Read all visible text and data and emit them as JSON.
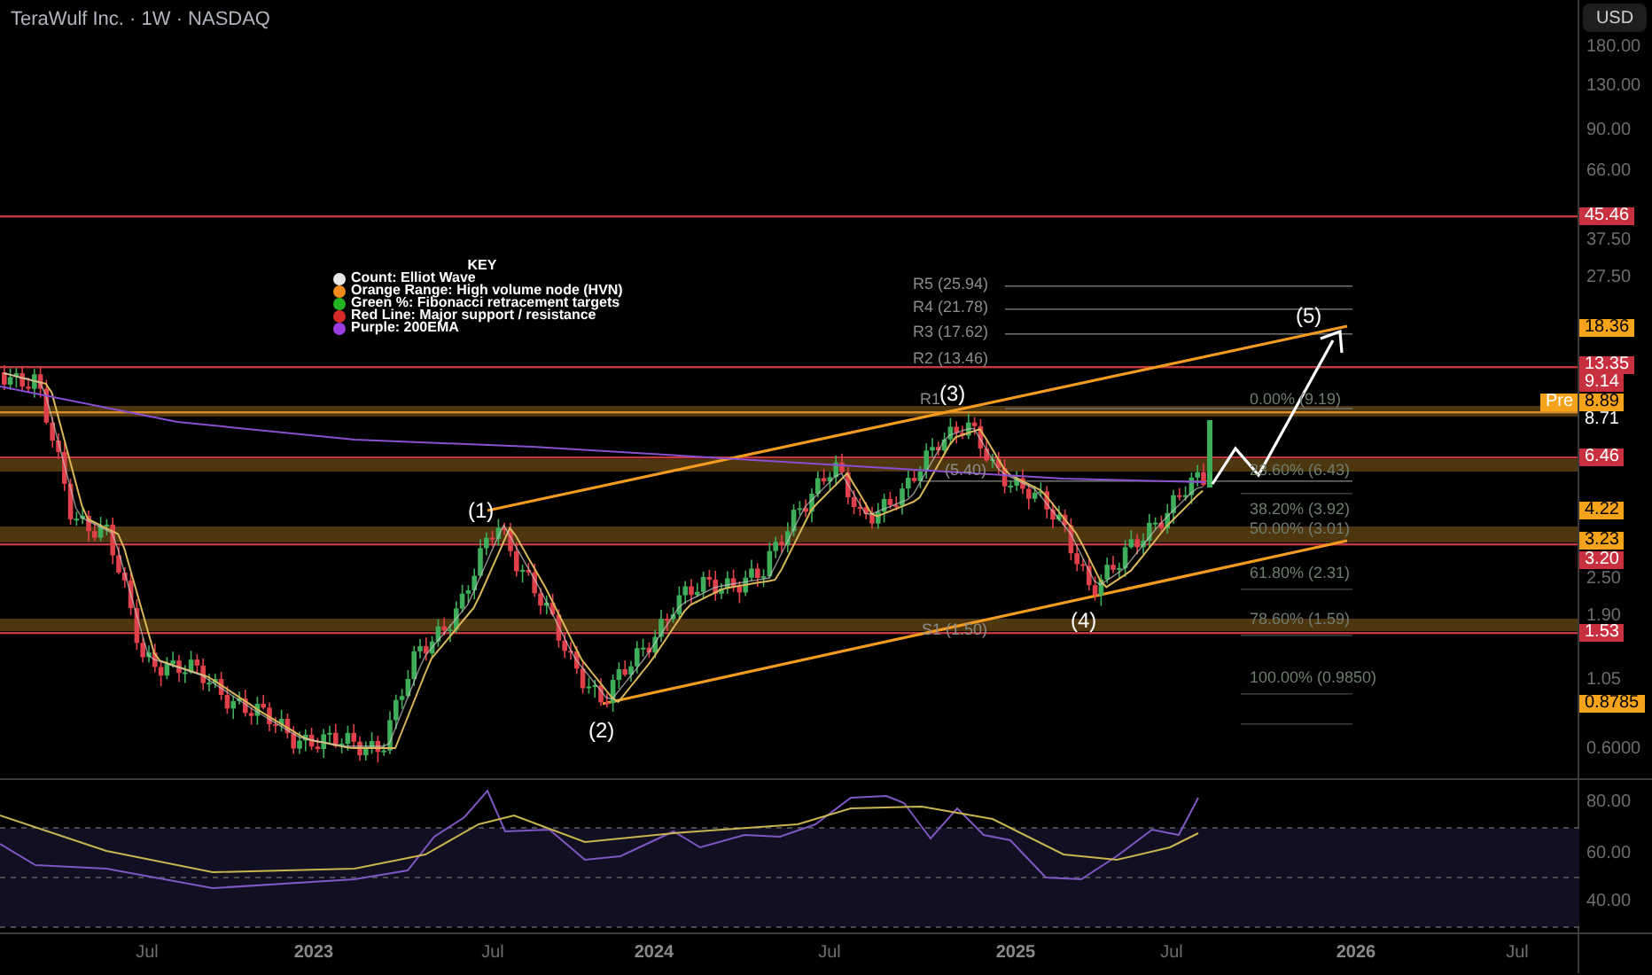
{
  "header": {
    "title": "TeraWulf Inc. · 1W · NASDAQ"
  },
  "currency_button": "USD",
  "legend": {
    "title": "KEY",
    "items": [
      {
        "label": "Count: Elliot Wave",
        "color": "#e8e8e8"
      },
      {
        "label": "Orange Range: High volume node (HVN)",
        "color": "#f08a1c"
      },
      {
        "label": "Green %: Fibonacci retracement targets",
        "color": "#22b422"
      },
      {
        "label": "Red Line: Major support / resistance",
        "color": "#d92a2a"
      },
      {
        "label": "Purple: 200EMA",
        "color": "#9b3de0"
      }
    ]
  },
  "wave_labels": [
    "(1)",
    "(2)",
    "(3)",
    "(4)",
    "(5)"
  ],
  "pivot_labels": [
    "R5 (25.94)",
    "R4 (21.78)",
    "R3 (17.62)",
    "R2 (13.46)",
    "R1",
    "(5.40)",
    "S1 (1.50)"
  ],
  "fib_labels": [
    "0.00% (9.19)",
    "23.60% (6.43)",
    "38.20% (3.92)",
    "50.00% (3.01)",
    "61.80% (2.31)",
    "78.60% (1.59)",
    "100.00% (0.9850)"
  ],
  "price_axis": {
    "ticks": [
      "180.00",
      "130.00",
      "90.00",
      "66.00",
      "37.50",
      "27.50",
      "2.50",
      "1.90",
      "1.05",
      "0.6000"
    ]
  },
  "price_tags": [
    {
      "value": "45.46",
      "kind": "alert"
    },
    {
      "value": "18.36",
      "kind": "drawing"
    },
    {
      "value": "13.35",
      "kind": "alert"
    },
    {
      "value": "9.14",
      "kind": "alert"
    },
    {
      "value": "8.89",
      "kind": "drawing"
    },
    {
      "value": "8.71",
      "kind": "last"
    },
    {
      "value": "6.46",
      "kind": "alert"
    },
    {
      "value": "4.22",
      "kind": "drawing"
    },
    {
      "value": "3.23",
      "kind": "drawing"
    },
    {
      "value": "3.20",
      "kind": "alert"
    },
    {
      "value": "1.53",
      "kind": "alert"
    },
    {
      "value": "0.8785",
      "kind": "drawing"
    }
  ],
  "pre_tag": "Pre",
  "rsi_axis": {
    "ticks": [
      "80.00",
      "60.00",
      "40.00"
    ]
  },
  "time_axis": [
    {
      "label": "Jul",
      "kind": "month"
    },
    {
      "label": "2023",
      "kind": "year"
    },
    {
      "label": "Jul",
      "kind": "month"
    },
    {
      "label": "2024",
      "kind": "year"
    },
    {
      "label": "Jul",
      "kind": "month"
    },
    {
      "label": "2025",
      "kind": "year"
    },
    {
      "label": "Jul",
      "kind": "month"
    },
    {
      "label": "2026",
      "kind": "year"
    },
    {
      "label": "Jul",
      "kind": "month"
    }
  ]
}
